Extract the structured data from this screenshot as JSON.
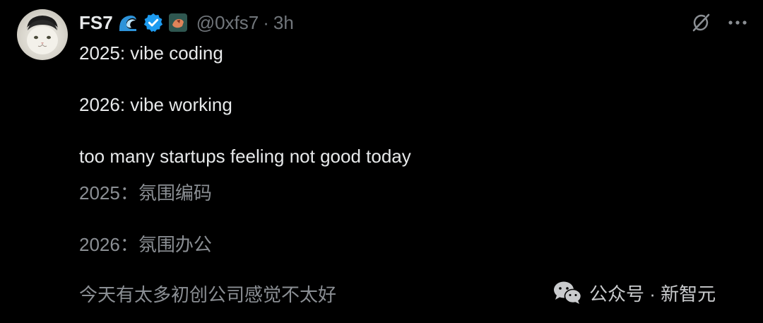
{
  "author": {
    "name": "FS7",
    "handle": "@0xfs7",
    "separator": "·",
    "time": "3h"
  },
  "tweet_lines": [
    "2025: vibe coding",
    "2026: vibe working",
    "too many startups feeling not good today"
  ],
  "translation_lines": [
    "2025：氛围编码",
    "2026：氛围办公",
    "今天有太多初创公司感觉不太好"
  ],
  "watermark": {
    "text": "公众号 · 新智元"
  },
  "colors": {
    "background": "#000000",
    "primary_text": "#e7e9ea",
    "secondary_text": "#71767b",
    "verified_blue": "#1d9bf0"
  },
  "icons": {
    "verified": "verified-badge-icon",
    "wave_emoji": "wave-emoji-icon",
    "affiliate": "affiliate-badge-icon",
    "grok": "grok-icon",
    "more": "more-icon",
    "wechat": "wechat-icon"
  }
}
